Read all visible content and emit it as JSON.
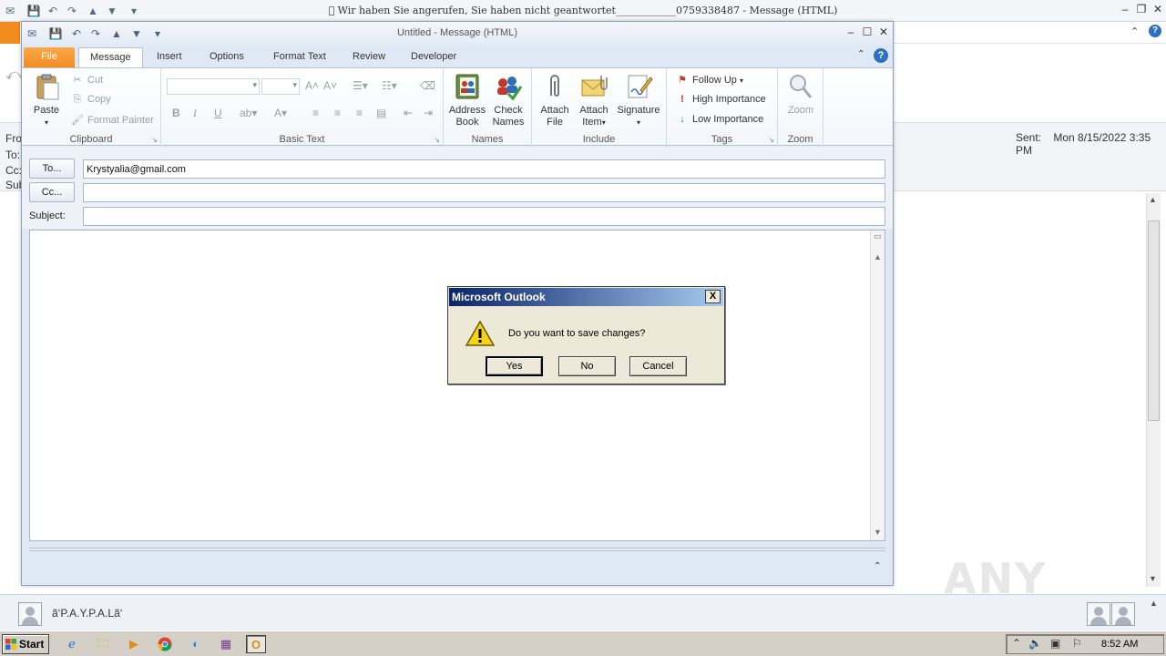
{
  "background_window": {
    "title": "\u0000 Wir haben Sie angerufen, Sie haben nicht geantwortet____________0759338487 - Message (HTML)",
    "header_labels": [
      "Fro",
      "To:",
      "Cc:",
      "Sub"
    ],
    "sent_label": "Sent:",
    "sent_value": "Mon 8/15/2022 3:35 PM",
    "sender_name": "ã‘P.A.Y.P.A.Lã‘",
    "watermark": "ANY RUN"
  },
  "compose": {
    "title": "Untitled - Message (HTML)",
    "tabs": [
      {
        "label": "File"
      },
      {
        "label": "Message"
      },
      {
        "label": "Insert"
      },
      {
        "label": "Options"
      },
      {
        "label": "Format Text"
      },
      {
        "label": "Review"
      },
      {
        "label": "Developer"
      }
    ],
    "ribbon": {
      "clipboard": {
        "label": "Clipboard",
        "paste": "Paste",
        "cut": "Cut",
        "copy": "Copy",
        "format_painter": "Format Painter"
      },
      "basic_text": {
        "label": "Basic Text"
      },
      "names": {
        "label": "Names",
        "address_book_1": "Address",
        "address_book_2": "Book",
        "check_names_1": "Check",
        "check_names_2": "Names"
      },
      "include": {
        "label": "Include",
        "attach_file_1": "Attach",
        "attach_file_2": "File",
        "attach_item_1": "Attach",
        "attach_item_2": "Item",
        "signature": "Signature"
      },
      "tags": {
        "label": "Tags",
        "follow_up": "Follow Up",
        "high_importance": "High Importance",
        "low_importance": "Low Importance"
      },
      "zoom": {
        "label": "Zoom",
        "zoom_btn": "Zoom"
      }
    },
    "fields": {
      "to_button": "To...",
      "to_value": "Krystyalia@gmail.com",
      "cc_button": "Cc...",
      "cc_value": "",
      "subject_label": "Subject:",
      "subject_value": ""
    }
  },
  "dialog": {
    "title": "Microsoft Outlook",
    "message": "Do you want to save changes?",
    "buttons": {
      "yes": "Yes",
      "no": "No",
      "cancel": "Cancel"
    },
    "close": "X"
  },
  "taskbar": {
    "start": "Start",
    "clock": "8:52 AM"
  },
  "colors": {
    "file_tab": "#f28c1f",
    "dialog_title_start": "#0a246a",
    "dialog_title_end": "#a6caf0",
    "ribbon_bg": "#dfe8f5"
  }
}
